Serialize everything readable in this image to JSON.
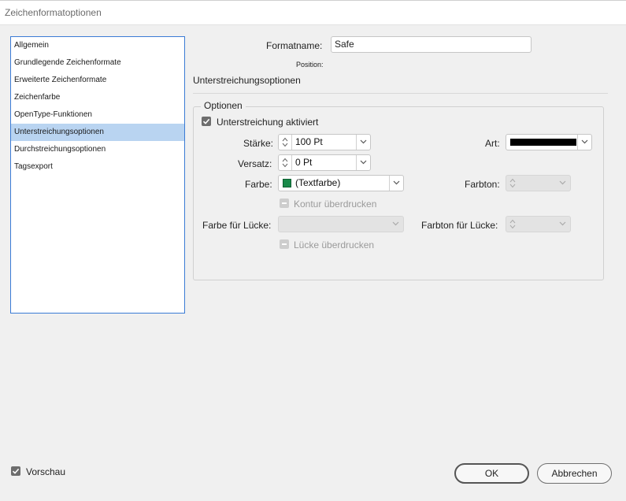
{
  "window": {
    "title": "Zeichenformatoptionen"
  },
  "sidebar": {
    "items": [
      {
        "label": "Allgemein"
      },
      {
        "label": "Grundlegende Zeichenformate"
      },
      {
        "label": "Erweiterte Zeichenformate"
      },
      {
        "label": "Zeichenfarbe"
      },
      {
        "label": "OpenType-Funktionen"
      },
      {
        "label": "Unterstreichungsoptionen"
      },
      {
        "label": "Durchstreichungsoptionen"
      },
      {
        "label": "Tagsexport"
      }
    ],
    "selected_label": "Unterstreichungsoptionen"
  },
  "header": {
    "formatname_label": "Formatname:",
    "formatname_value": "Safe",
    "position_label": "Position:"
  },
  "section": {
    "title": "Unterstreichungsoptionen",
    "group_legend": "Optionen",
    "underline_enabled_label": "Unterstreichung aktiviert",
    "underline_enabled": true,
    "staerke_label": "Stärke:",
    "staerke_value": "100 Pt",
    "art_label": "Art:",
    "versatz_label": "Versatz:",
    "versatz_value": "0 Pt",
    "farbe_label": "Farbe:",
    "farbe_value": "(Textfarbe)",
    "farbe_swatch_color": "#1a8a4a",
    "farbton_label": "Farbton:",
    "kontur_label": "Kontur überdrucken",
    "farbe_luecke_label": "Farbe für Lücke:",
    "farbton_luecke_label": "Farbton für Lücke:",
    "luecke_label": "Lücke überdrucken"
  },
  "footer": {
    "vorschau_label": "Vorschau",
    "vorschau_checked": true,
    "ok_label": "OK",
    "cancel_label": "Abbrechen"
  },
  "colors": {
    "selection": "#b9d4f1",
    "accent_border": "#3a7bd5"
  }
}
